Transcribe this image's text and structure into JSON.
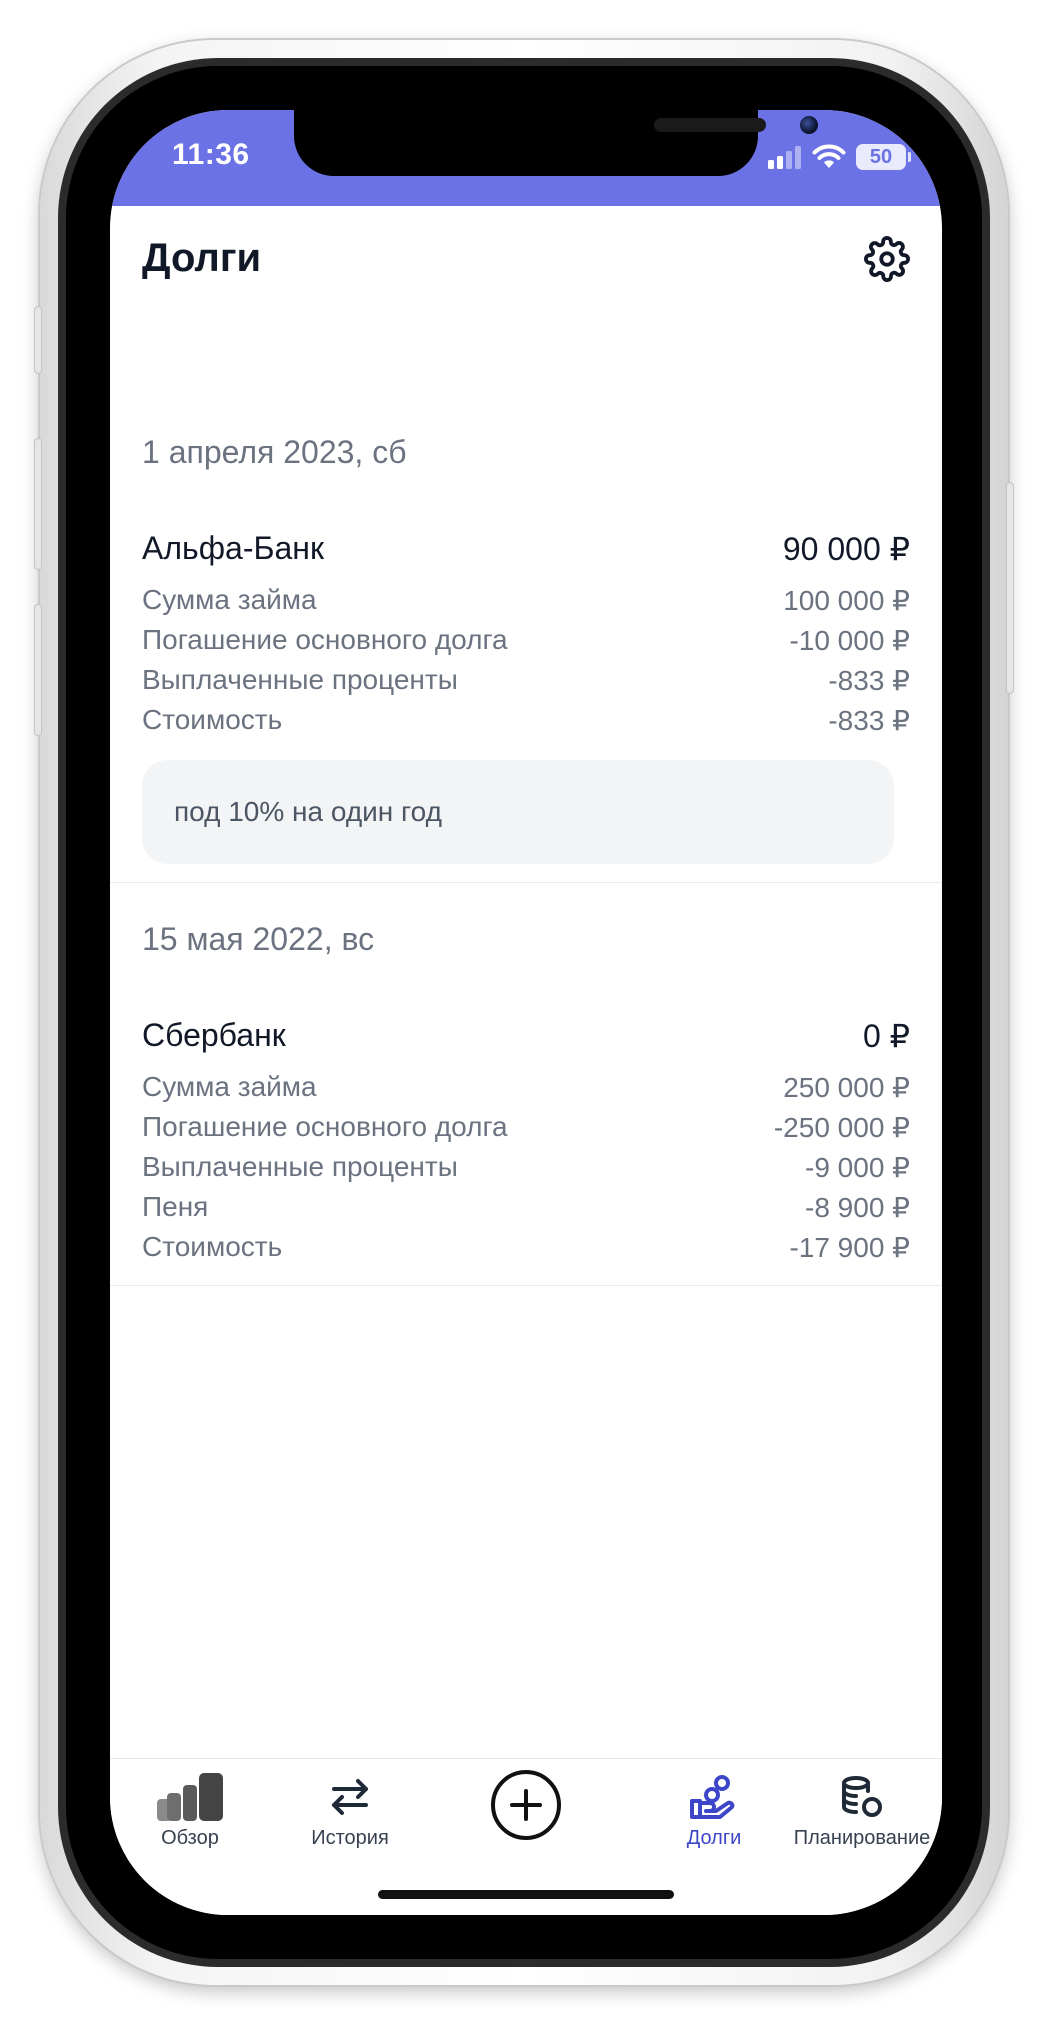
{
  "status_bar": {
    "time": "11:36",
    "battery": "50"
  },
  "header": {
    "title": "Долги",
    "settings_icon": "gear-icon"
  },
  "debts": [
    {
      "date": "1 апреля 2023, сб",
      "name": "Альфа-Банк",
      "total": "90 000 ₽",
      "rows": [
        {
          "label": "Сумма займа",
          "value": "100 000 ₽"
        },
        {
          "label": "Погашение основного долга",
          "value": "-10 000 ₽"
        },
        {
          "label": "Выплаченные проценты",
          "value": "-833 ₽"
        },
        {
          "label": "Стоимость",
          "value": "-833 ₽"
        }
      ],
      "note": "под 10% на один год"
    },
    {
      "date": "15 мая 2022, вс",
      "name": "Сбербанк",
      "total": "0 ₽",
      "rows": [
        {
          "label": "Сумма займа",
          "value": "250 000 ₽"
        },
        {
          "label": "Погашение основного долга",
          "value": "-250 000 ₽"
        },
        {
          "label": "Выплаченные проценты",
          "value": "-9 000 ₽"
        },
        {
          "label": "Пеня",
          "value": "-8 900 ₽"
        },
        {
          "label": "Стоимость",
          "value": "-17 900 ₽"
        }
      ]
    }
  ],
  "tabbar": {
    "tabs": [
      {
        "label": "Обзор",
        "icon": "bar-chart-icon"
      },
      {
        "label": "История",
        "icon": "swap-arrows-icon"
      },
      {
        "label": "",
        "icon": "plus-circle-icon"
      },
      {
        "label": "Долги",
        "icon": "hand-coins-icon",
        "active": true
      },
      {
        "label": "Планирование",
        "icon": "coins-stack-icon"
      }
    ],
    "active_color": "#3d46c9"
  },
  "colors": {
    "status_bar": "#6a72e6",
    "text_primary": "#111827",
    "text_secondary": "#6b7280"
  }
}
